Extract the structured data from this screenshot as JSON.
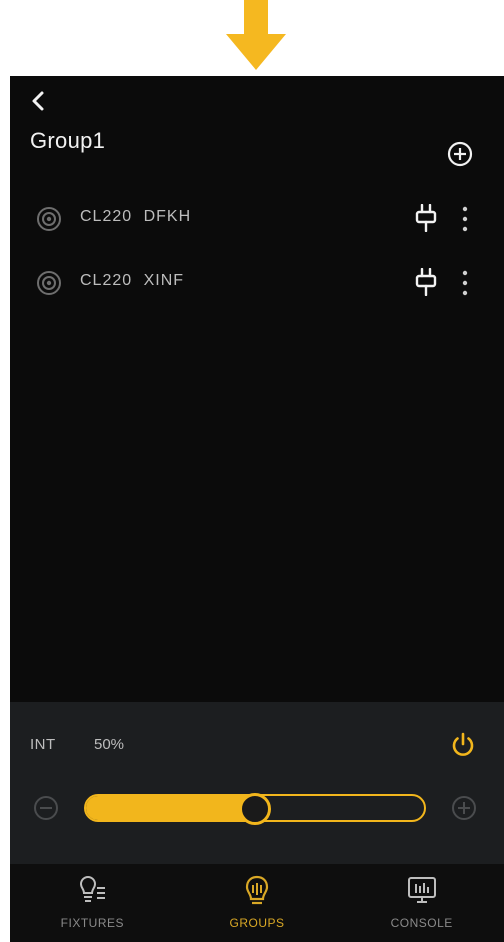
{
  "header": {
    "title": "Group1"
  },
  "fixtures": [
    {
      "label": "CL220  DFKH"
    },
    {
      "label": "CL220  XINF"
    }
  ],
  "control": {
    "int_label": "INT",
    "int_value": "50%",
    "level_percent": 50
  },
  "nav": [
    {
      "label": "FIXTURES",
      "active": false
    },
    {
      "label": "GROUPS",
      "active": true
    },
    {
      "label": "CONSOLE",
      "active": false
    }
  ],
  "colors": {
    "accent": "#f2b61c",
    "background": "#0b0b0b",
    "panel": "#1c1e20",
    "arrow": "#f5b820"
  },
  "icons": {
    "top": "down-arrow-icon",
    "back": "back-chevron-icon",
    "add": "add-circle-icon",
    "fixture": "target-icon",
    "fixture_status": "plug-icon",
    "fixture_menu": "more-vertical-icon",
    "power": "power-icon",
    "decrease": "minus-circle-icon",
    "increase": "plus-circle-icon"
  }
}
